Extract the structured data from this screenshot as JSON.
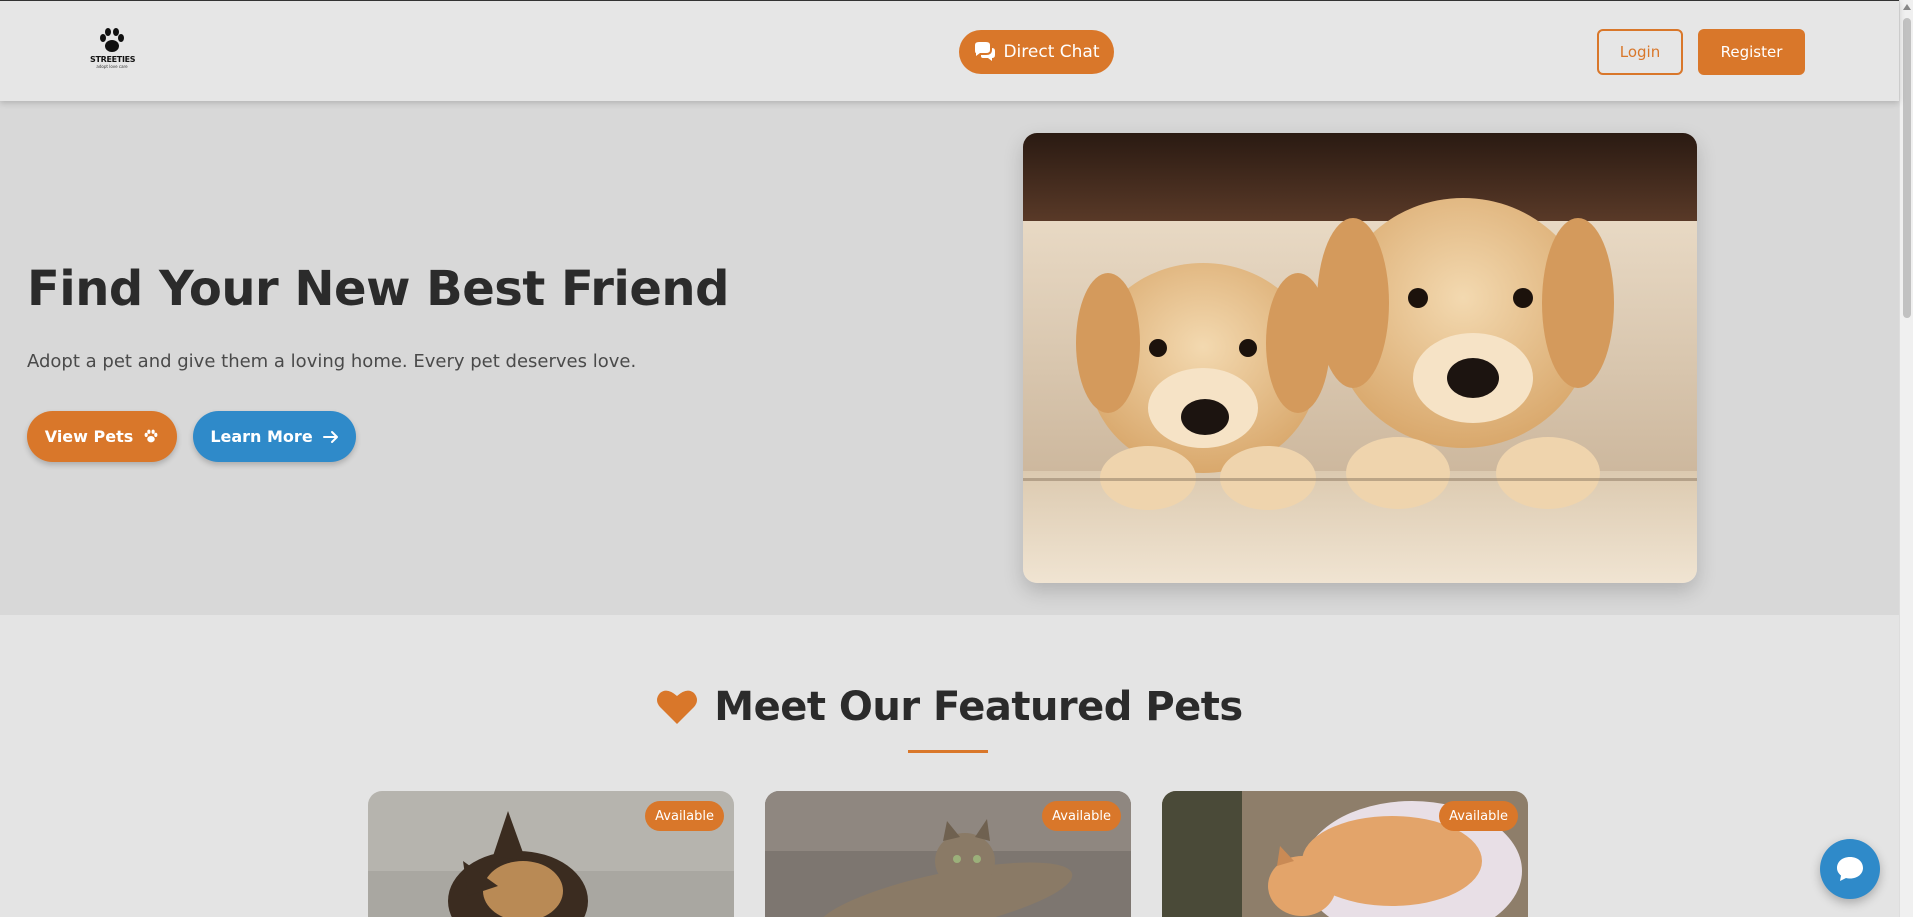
{
  "navbar": {
    "logo_brand": "STREETIES",
    "logo_tagline": "adopt love care",
    "chat_label": "Direct Chat",
    "login_label": "Login",
    "register_label": "Register"
  },
  "hero": {
    "title": "Find Your New Best Friend",
    "subtitle": "Adopt a pet and give them a loving home. Every pet deserves love.",
    "view_pets_label": "View Pets",
    "learn_more_label": "Learn More",
    "photo_icon": "puppies-photo"
  },
  "featured": {
    "title": "Meet Our Featured Pets",
    "cards": [
      {
        "badge": "Available",
        "photo": "german-shepherd-photo"
      },
      {
        "badge": "Available",
        "photo": "tabby-cat-photo"
      },
      {
        "badge": "Available",
        "photo": "orange-cat-photo"
      }
    ]
  },
  "colors": {
    "accent": "#d9772a",
    "secondary": "#2f8ac9",
    "text_dark": "#2b2b2b"
  }
}
